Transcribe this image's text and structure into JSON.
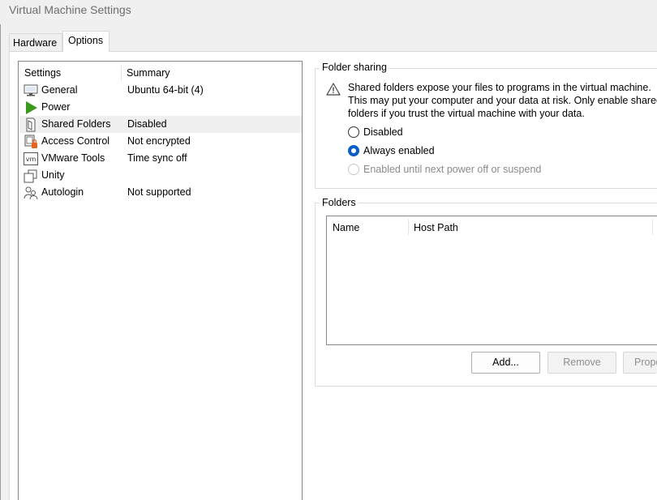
{
  "window": {
    "title": "Virtual Machine Settings"
  },
  "tabs": {
    "hardware": "Hardware",
    "options": "Options"
  },
  "settings_list": {
    "headers": {
      "settings": "Settings",
      "summary": "Summary"
    },
    "rows": [
      {
        "name": "General",
        "summary": "Ubuntu 64-bit (4)",
        "icon": "monitor-icon"
      },
      {
        "name": "Power",
        "summary": "",
        "icon": "play-icon"
      },
      {
        "name": "Shared Folders",
        "summary": "Disabled",
        "icon": "shared-folder-icon"
      },
      {
        "name": "Access Control",
        "summary": "Not encrypted",
        "icon": "lock-icon"
      },
      {
        "name": "VMware Tools",
        "summary": "Time sync off",
        "icon": "vmware-tools-icon"
      },
      {
        "name": "Unity",
        "summary": "",
        "icon": "unity-icon"
      },
      {
        "name": "Autologin",
        "summary": "Not supported",
        "icon": "users-icon"
      }
    ],
    "selected": "Shared Folders"
  },
  "folder_sharing": {
    "title": "Folder sharing",
    "warning": "Shared folders expose your files to programs in the virtual machine. This may put your computer and your data at risk. Only enable shared folders if you trust the virtual machine with your data.",
    "options": {
      "disabled": "Disabled",
      "always": "Always enabled",
      "until_poweroff": "Enabled until next power off or suspend"
    },
    "selected": "always"
  },
  "folders": {
    "title": "Folders",
    "columns": {
      "name": "Name",
      "host_path": "Host Path"
    },
    "buttons": {
      "add": "Add...",
      "remove": "Remove",
      "properties": "Prope"
    }
  },
  "colors": {
    "accent": "#0a5fc7",
    "power_green": "#3a9a1c",
    "warning_orange": "#e8641a"
  }
}
